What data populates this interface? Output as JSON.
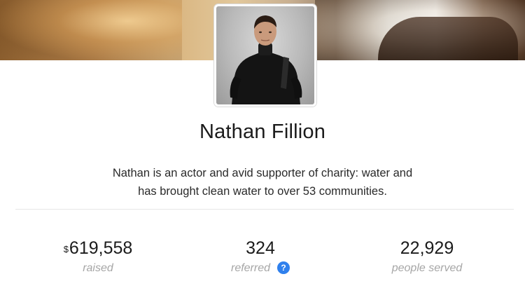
{
  "profile": {
    "name": "Nathan Fillion",
    "bio_line1": "Nathan is an actor and avid supporter of charity: water and",
    "bio_line2": "has brought clean water to over 53 communities."
  },
  "stats": {
    "raised": {
      "currency": "$",
      "value": "619,558",
      "label": "raised"
    },
    "referred": {
      "value": "324",
      "label": "referred",
      "help_icon": "?"
    },
    "people_served": {
      "value": "22,929",
      "label": "people served"
    }
  },
  "colors": {
    "help_icon": "#2f80ed",
    "label_gray": "#a6a6a6",
    "text": "#1b1b1b"
  }
}
